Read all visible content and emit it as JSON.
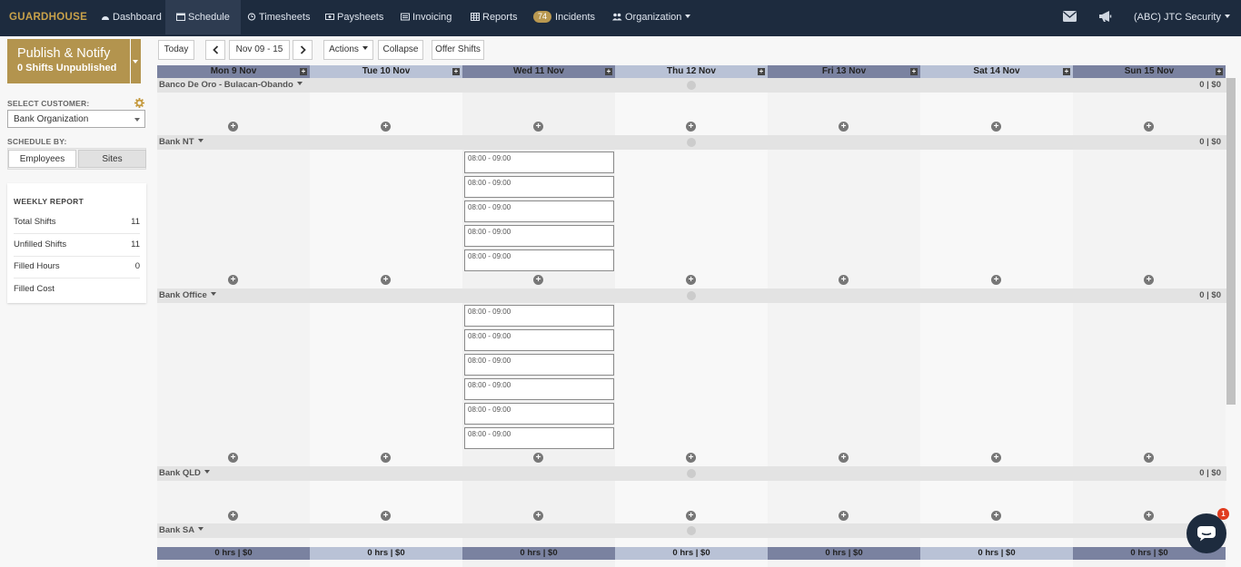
{
  "nav": {
    "brand": "GUARDHOUSE",
    "items": [
      {
        "label": "Dashboard",
        "icon": "dashboard-icon"
      },
      {
        "label": "Schedule",
        "icon": "calendar-icon"
      },
      {
        "label": "Timesheets",
        "icon": "clock-icon"
      },
      {
        "label": "Paysheets",
        "icon": "paysheet-icon"
      },
      {
        "label": "Invoicing",
        "icon": "invoice-icon"
      },
      {
        "label": "Reports",
        "icon": "table-icon"
      },
      {
        "label": "Incidents",
        "icon": "badge",
        "badge": "74"
      },
      {
        "label": "Organization",
        "icon": "users-icon"
      }
    ],
    "account": "(ABC) JTC Security"
  },
  "publish": {
    "title": "Publish & Notify",
    "subtitle": "0 Shifts Unpublished"
  },
  "sidebar": {
    "select_customer_label": "SELECT CUSTOMER:",
    "customer": "Bank Organization",
    "schedule_by_label": "SCHEDULE BY:",
    "schedule_by": [
      "Employees",
      "Sites"
    ],
    "report": {
      "title": "WEEKLY REPORT",
      "rows": [
        {
          "label": "Total Shifts",
          "value": "11"
        },
        {
          "label": "Unfilled Shifts",
          "value": "11"
        },
        {
          "label": "Filled Hours",
          "value": "0"
        },
        {
          "label": "Filled Cost",
          "value": ""
        }
      ]
    }
  },
  "toolbar": {
    "today": "Today",
    "range": "Nov 09 - 15",
    "actions": "Actions",
    "collapse": "Collapse",
    "offer": "Offer Shifts"
  },
  "days": [
    "Mon 9 Nov",
    "Tue 10 Nov",
    "Wed 11 Nov",
    "Thu 12 Nov",
    "Fri 13 Nov",
    "Sat 14 Nov",
    "Sun 15 Nov"
  ],
  "groups": [
    {
      "name": "Banco De Oro - Bulacan-Obando",
      "summary": "0 | $0"
    },
    {
      "name": "Bank NT",
      "summary": "0 | $0"
    },
    {
      "name": "Bank Office",
      "summary": "0 | $0"
    },
    {
      "name": "Bank QLD",
      "summary": "0 | $0"
    },
    {
      "name": "Bank SA",
      "summary": ""
    }
  ],
  "shift_time": "08:00 - 09:00",
  "footer_total": "0 hrs  | $0",
  "chat_badge": "1"
}
